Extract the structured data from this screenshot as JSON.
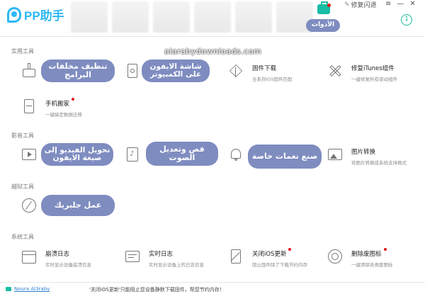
{
  "app": {
    "title": "PP助手",
    "toolbox_label": "الأدوات",
    "repair_label": "修复闪退",
    "window_controls": [
      "≡",
      "—",
      "✕"
    ],
    "accent": "#19bca4",
    "brand": "#2db7f5",
    "overlay_color": "#7f8cc0"
  },
  "watermark": "alarabydownloads.com",
  "sections": [
    {
      "title": "实用工具",
      "tools": [
        {
          "name": "",
          "desc": "",
          "icon": "broom-icon",
          "overlay": "تنظيف مخلفات البرامج"
        },
        {
          "name": "",
          "desc": "",
          "icon": "screen-icon",
          "overlay": "شاشة الايفون على الكمبيوتر"
        },
        {
          "name": "固件下载",
          "desc": "全系列iOS固件匹配",
          "icon": "cube-icon"
        },
        {
          "name": "修复iTunes组件",
          "desc": "一键修复所有驱动组件",
          "icon": "tools-icon"
        },
        {
          "name": "手机搬家",
          "desc": "一键搞定数据迁移",
          "icon": "transfer-icon",
          "dot": true
        }
      ]
    },
    {
      "title": "影音工具",
      "tools": [
        {
          "name": "",
          "desc": "",
          "icon": "video-icon",
          "overlay": "تحويل الفيديو إلى صيغة الايفون"
        },
        {
          "name": "",
          "desc": "",
          "icon": "music-icon",
          "overlay": "قص وتعديل الصوت"
        },
        {
          "name": "",
          "desc": "",
          "icon": "bell-icon",
          "overlay": "صنع نغمات خاصة"
        },
        {
          "name": "图片转换",
          "desc": "将图片转换成系统支持格式",
          "icon": "image-icon"
        }
      ]
    },
    {
      "title": "越狱工具",
      "tools": [
        {
          "name": "",
          "desc": "",
          "icon": "jailbreak-icon",
          "overlay": "عمل جلبريك"
        }
      ]
    },
    {
      "title": "系统工具",
      "tools": [
        {
          "name": "崩溃日志",
          "desc": "实时显示设备崩溃信息",
          "icon": "calendar-icon"
        },
        {
          "name": "实时日志",
          "desc": "实时显示设备上的日志信息",
          "icon": "log-icon"
        },
        {
          "name": "关闭iOS更新",
          "desc": "阻止固件除了下载节约内存",
          "icon": "block-update-icon",
          "dot": true
        },
        {
          "name": "删除废图标",
          "desc": "一键清除各类废图标",
          "icon": "delete-icon-icon",
          "dot": true
        }
      ]
    }
  ],
  "status": {
    "link": "Noura Al3raby",
    "message": "'关闭iOS更新'只能阻止您设备静默下载固件，帮您节约内存！"
  }
}
